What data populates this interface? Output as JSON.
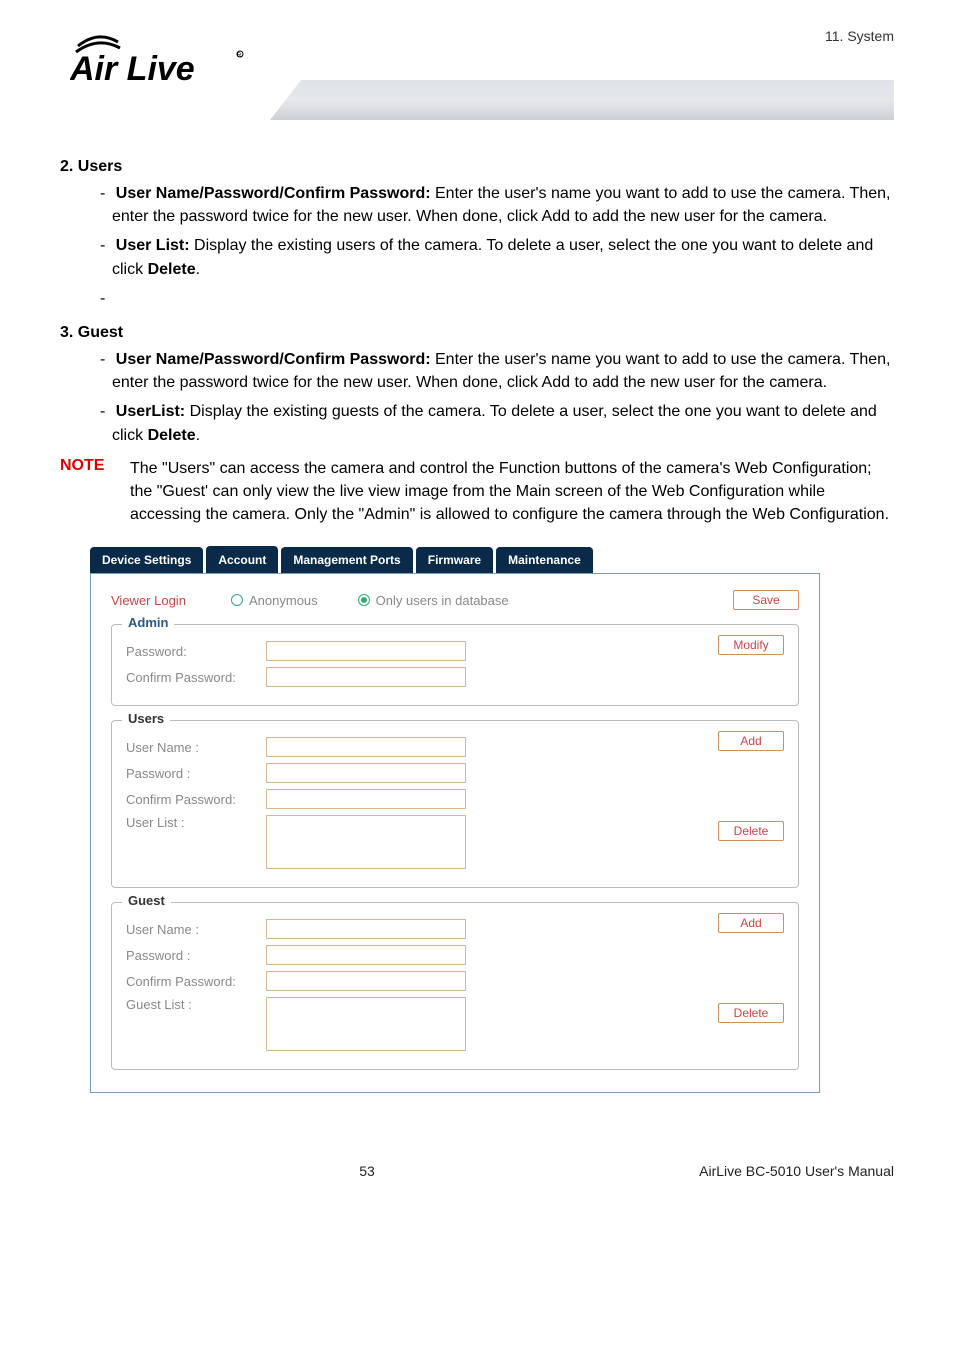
{
  "header": {
    "section_label": "11.  System",
    "logo_text": "Air Live"
  },
  "body": {
    "users_heading": "2. Users",
    "users_items": [
      {
        "bold": "User Name/Password/Confirm Password:",
        "rest": " Enter the user's name you want to add to use the camera. Then, enter the password twice for the new user. When done, click Add to add the new user for the camera."
      },
      {
        "bold": "User List:",
        "rest": " Display the existing users of the camera. To delete a user, select the one you want to delete and click ",
        "bold2": "Delete",
        "rest2": "."
      }
    ],
    "lone_dash": "-",
    "guest_heading": "3. Guest",
    "guest_items": [
      {
        "bold": "User Name/Password/Confirm Password:",
        "rest": " Enter the user's name you want to add to use the camera. Then, enter the password twice for the new user. When done, click Add to add the new user for the camera."
      },
      {
        "bold": "UserList:",
        "rest": " Display the existing guests of the camera. To delete a user, select the one you want to delete and click ",
        "bold2": "Delete",
        "rest2": "."
      }
    ],
    "note_label": "NOTE",
    "note_text": "The \"Users\" can access the camera and control the Function buttons of the camera's Web Configuration; the \"Guest' can only view the live view image from the Main screen of the Web Configuration while accessing the camera. Only the \"Admin\" is allowed to configure the camera through the Web Configuration."
  },
  "ui": {
    "tabs": [
      "Device Settings",
      "Account",
      "Management Ports",
      "Firmware",
      "Maintenance"
    ],
    "active_tab_index": 1,
    "viewer_login_label": "Viewer Login",
    "radio_anonymous": "Anonymous",
    "radio_only_users": "Only users in database",
    "selected_radio": "only_users",
    "save_btn": "Save",
    "admin": {
      "legend": "Admin",
      "password_label": "Password:",
      "confirm_label": "Confirm Password:",
      "modify_btn": "Modify"
    },
    "users": {
      "legend": "Users",
      "username_label": "User Name :",
      "password_label": "Password :",
      "confirm_label": "Confirm Password:",
      "list_label": "User List :",
      "add_btn": "Add",
      "delete_btn": "Delete"
    },
    "guest": {
      "legend": "Guest",
      "username_label": "User Name :",
      "password_label": "Password :",
      "confirm_label": "Confirm Password:",
      "list_label": "Guest List :",
      "add_btn": "Add",
      "delete_btn": "Delete"
    }
  },
  "footer": {
    "page_number": "53",
    "doc_title": "AirLive  BC-5010  User's  Manual"
  }
}
